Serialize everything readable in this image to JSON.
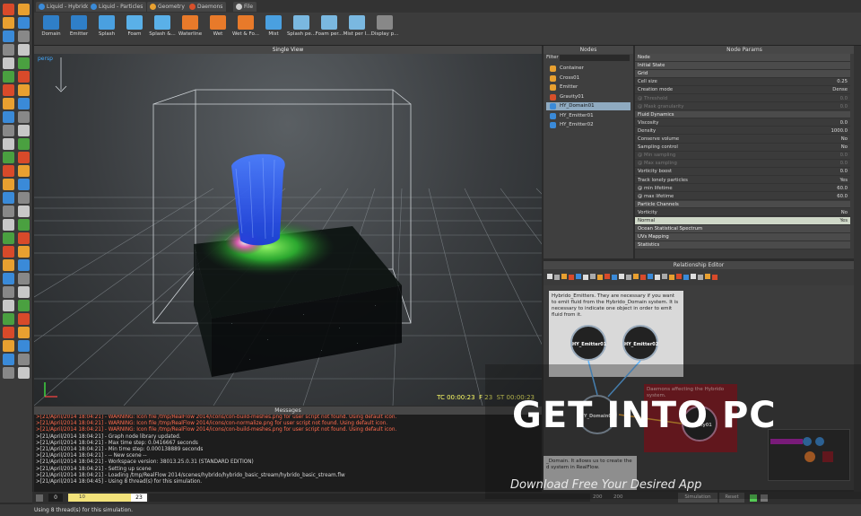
{
  "tabs": [
    {
      "label": "Liquid - Hybrido",
      "color": "#3a8ad8"
    },
    {
      "label": "Liquid - Particles",
      "color": "#3a8ad8"
    },
    {
      "label": "Geometry",
      "color": "#e8a030"
    },
    {
      "label": "Daemons",
      "color": "#d8502a"
    },
    {
      "label": "File",
      "color": "#cccccc"
    }
  ],
  "shelf": [
    {
      "label": "Domain",
      "icon": "domain-icon",
      "color": "#2f7fc8"
    },
    {
      "label": "Emitter",
      "icon": "emitter-icon",
      "color": "#2f7fc8"
    },
    {
      "label": "Splash",
      "icon": "splash-icon",
      "color": "#4aa0e0"
    },
    {
      "label": "Foam",
      "icon": "foam-icon",
      "color": "#5ab0e8"
    },
    {
      "label": "Splash &...",
      "icon": "splash-foam-icon",
      "color": "#5ab0e8"
    },
    {
      "label": "Waterline",
      "icon": "waterline-icon",
      "color": "#e87a2a"
    },
    {
      "label": "Wet",
      "icon": "wet-icon",
      "color": "#e87a2a"
    },
    {
      "label": "Wet & Fo...",
      "icon": "wet-foam-icon",
      "color": "#e87a2a"
    },
    {
      "label": "Mist",
      "icon": "mist-icon",
      "color": "#4aa0e0"
    },
    {
      "label": "Splash pe...",
      "icon": "splash-mesh-icon",
      "color": "#7ab8e0"
    },
    {
      "label": "Foam per...",
      "icon": "foam-mesh-icon",
      "color": "#7ab8e0"
    },
    {
      "label": "Mist per I...",
      "icon": "mist-mesh-icon",
      "color": "#7ab8e0"
    },
    {
      "label": "Display p...",
      "icon": "gear-icon",
      "color": "#888888"
    }
  ],
  "viewport": {
    "title": "Single View",
    "info": "persp",
    "tc": "TC 00:00:23",
    "frame": "F 23",
    "st": "ST 00:00:23"
  },
  "messages": {
    "title": "Messages",
    "lines": [
      {
        "t": ">[21/April/2014 18:04:21] - WARNING: Icon file /tmp/RealFlow 2014/icons/con-build-meshes.png for user script not found. Using default icon.",
        "w": true
      },
      {
        "t": ">[21/April/2014 18:04:21] - WARNING: Icon file /tmp/RealFlow 2014/icons/con-normalize.png for user script not found. Using default icon.",
        "w": true
      },
      {
        "t": ">[21/April/2014 18:04:21] - WARNING: Icon file /tmp/RealFlow 2014/icons/con-build-meshes.png for user script not found. Using default icon.",
        "w": true
      },
      {
        "t": ">[21/April/2014 18:04:21] - Graph node library updated.",
        "w": false
      },
      {
        "t": ">[21/April/2014 18:04:21] - Max time step: 0.0416667 seconds",
        "w": false
      },
      {
        "t": ">[21/April/2014 18:04:21] - Min time step: 0.000138889 seconds",
        "w": false
      },
      {
        "t": ">[21/April/2014 18:04:21] - -- New scene --",
        "w": false
      },
      {
        "t": ">[21/April/2014 18:04:21] - Workspace version: 38013.25.0.31 (STANDARD EDITION)",
        "w": false
      },
      {
        "t": ">[21/April/2014 18:04:21] - Setting up scene",
        "w": false
      },
      {
        "t": ">[21/April/2014 18:04:21] - Loading /tmp/RealFlow 2014/scenes/hybrido/hybrido_basic_stream/hybrido_basic_stream.flw",
        "w": false
      },
      {
        "t": ">[21/April/2014 18:04:45] - Using 8 thread(s) for this simulation.",
        "w": false
      }
    ]
  },
  "timeline": {
    "start": "0",
    "current": "23",
    "marks": [
      "10",
      "20",
      "200",
      "200"
    ],
    "mode": "Simulation",
    "reset": "Reset"
  },
  "status": "Using 8 thread(s) for this simulation.",
  "nodes": {
    "title": "Nodes",
    "filter_label": "Filter",
    "items": [
      {
        "label": "Container",
        "color": "#e8a030",
        "selected": false
      },
      {
        "label": "Cross01",
        "color": "#e8a030",
        "selected": false
      },
      {
        "label": "Emitter",
        "color": "#e8a030",
        "selected": false
      },
      {
        "label": "Gravity01",
        "color": "#d8502a",
        "selected": false
      },
      {
        "label": "HY_Domain01",
        "color": "#3a8ad8",
        "selected": true
      },
      {
        "label": "HY_Emitter01",
        "color": "#3a8ad8",
        "selected": false
      },
      {
        "label": "HY_Emitter02",
        "color": "#3a8ad8",
        "selected": false
      }
    ]
  },
  "params": {
    "title": "Node Params",
    "rows": [
      {
        "k": "Node",
        "v": "",
        "type": "sec"
      },
      {
        "k": "Initial State",
        "v": "",
        "type": "sec"
      },
      {
        "k": "Grid",
        "v": "",
        "type": "sec"
      },
      {
        "k": "Cell size",
        "v": "0.25",
        "type": ""
      },
      {
        "k": "Creation mode",
        "v": "Dense",
        "type": ""
      },
      {
        "k": "@ Threshold",
        "v": "0.0",
        "type": "dim"
      },
      {
        "k": "@ Mask granularity",
        "v": "0.0",
        "type": "dim"
      },
      {
        "k": "Fluid Dynamics",
        "v": "",
        "type": "sec"
      },
      {
        "k": "Viscosity",
        "v": "0.0",
        "type": ""
      },
      {
        "k": "Density",
        "v": "1000.0",
        "type": ""
      },
      {
        "k": "Conserve volume",
        "v": "No",
        "type": ""
      },
      {
        "k": "Sampling control",
        "v": "No",
        "type": ""
      },
      {
        "k": "@ Min sampling",
        "v": "0.0",
        "type": "dim"
      },
      {
        "k": "@ Max sampling",
        "v": "0.0",
        "type": "dim"
      },
      {
        "k": "Vorticity boost",
        "v": "0.0",
        "type": ""
      },
      {
        "k": "Track lonely particles",
        "v": "Yes",
        "type": ""
      },
      {
        "k": "@ min lifetime",
        "v": "60.0",
        "type": ""
      },
      {
        "k": "@ max lifetime",
        "v": "60.0",
        "type": ""
      },
      {
        "k": "Particle Channels",
        "v": "",
        "type": "sec"
      },
      {
        "k": "Vorticity",
        "v": "No",
        "type": ""
      },
      {
        "k": "Normal",
        "v": "Yes",
        "type": "hl"
      },
      {
        "k": "Ocean Statistical Spectrum",
        "v": "",
        "type": "sec"
      },
      {
        "k": "UVs Mapping",
        "v": "",
        "type": "sec"
      },
      {
        "k": "Statistics",
        "v": "",
        "type": "sec"
      }
    ]
  },
  "relationship": {
    "title": "Relationship Editor",
    "emitters_note": "Hybrido_Emitters. They are necessary if you want to emit fluid from the Hybrido_Domain system. It is necessary to indicate one object in order to emit fluid from it.",
    "daemons_note": "Daemons affecting the Hybrido system.",
    "domain_note": "_Domain. It allows us to create the d system in RealFlow.",
    "nodes": [
      "HY_Emitter01",
      "HY_Emitter02",
      "HY_Domain01",
      "Gravity01"
    ]
  },
  "watermark": {
    "title": "GET INTO PC",
    "subtitle": "Download Free Your Desired App"
  }
}
